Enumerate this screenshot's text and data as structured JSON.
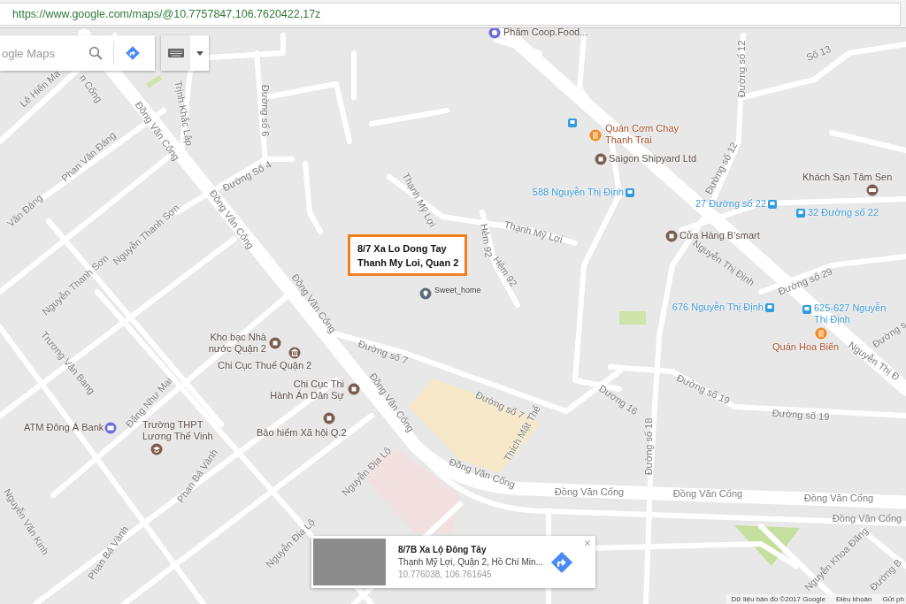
{
  "address_bar": {
    "url": "https://www.google.com/maps/@10.7757847,106.7620422,17z"
  },
  "search_panel": {
    "placeholder": "ogle Maps"
  },
  "callout": {
    "lines": [
      "8/7 Xa Lo Dong Tay",
      "Thanh My Loi, Quan 2"
    ]
  },
  "street_labels": [
    "Lê Hiến Ma",
    "n Cống",
    "Đồng Văn Cống",
    "Trịnh Khắc Lập",
    "Đường số 6",
    "Phan Văn Đáng",
    "Đường Số 4",
    "Đồng Văn Cống",
    "Văn Đáng",
    "Nguyễn Thanh Sơn",
    "Nguyễn Thanh Sơn",
    "Trương Văn Bang",
    "Đồng Văn Cống",
    "Đặng Như Mai",
    "Đồng Văn Cống",
    "Đường số 7",
    "Thạnh Mỹ Lợi",
    "Thạnh Mỹ Lợi",
    "Hẻm 92",
    "Hẻm 92",
    "Đường số 12",
    "Đường số 12",
    "Số 13",
    "Nguyễn Thị Định",
    "Đường số 29",
    "Đường số 19",
    "Đường số 19",
    "Đường số 7",
    "Dương 16",
    "Thích Mật Thể",
    "Đường số 18",
    "Đồng Văn Cống",
    "Đồng Văn Cống",
    "Đồng Văn Cống",
    "Đồng Văn Cống",
    "Đồng Văn Cống",
    "Nguyễn Thị Đ",
    "Đường s",
    "Nguyễn Khoa Đăng",
    "Đường B",
    "Nguyễn Địa Lộ",
    "Nguyễn Địa Lộ",
    "Phan Bá Vành",
    "Phan Bá Vành",
    "Nguyễn Văn Kinh"
  ],
  "places": [
    {
      "label": "Phẩm Coop.Food...",
      "kind": "grocery"
    },
    {
      "label": "Quán Cơm Chay\nThanh Trai",
      "kind": "food"
    },
    {
      "label": "Saigon Shipyard Ltd",
      "kind": "shop"
    },
    {
      "label": "588 Nguyễn Thị Định",
      "kind": "bus"
    },
    {
      "label": "Khách Sạn Tâm Sen",
      "kind": "hotel"
    },
    {
      "label": "27 Đường số 22",
      "kind": "bus"
    },
    {
      "label": "32 Đường số 22",
      "kind": "bus"
    },
    {
      "label": "Cửa Hàng B'smart",
      "kind": "shop"
    },
    {
      "label": "676 Nguyễn Thị Định",
      "kind": "bus"
    },
    {
      "label": "625-627 Nguyễn\nThị Định",
      "kind": "bus"
    },
    {
      "label": "Quán Hoa Biển",
      "kind": "food"
    },
    {
      "label": "Sweet_home",
      "kind": "home"
    },
    {
      "label": "Kho bạc Nhà\nnước Quận 2",
      "kind": "shop"
    },
    {
      "label": "Chi Cục Thuế Quận 2",
      "kind": "gov"
    },
    {
      "label": "Chi Cục Thi\nHành Án Dân Sự",
      "kind": "shop"
    },
    {
      "label": "ATM Đông Á Bank",
      "kind": "atm"
    },
    {
      "label": "Trường THPT\nLương Thế Vinh",
      "kind": "school"
    },
    {
      "label": "Bảo hiểm Xã hội Q.2",
      "kind": "shop"
    }
  ],
  "info_card": {
    "title": "8/7B Xa Lộ Đông Tây",
    "address": "Thạnh Mỹ Lợi, Quận 2, Hồ Chí Min...",
    "coordinates": "10.776038, 106.761645",
    "close": "×"
  },
  "footer": [
    "Dữ liệu bản đồ ©2017 Google",
    "Điều khoản",
    "Gửi ph"
  ]
}
